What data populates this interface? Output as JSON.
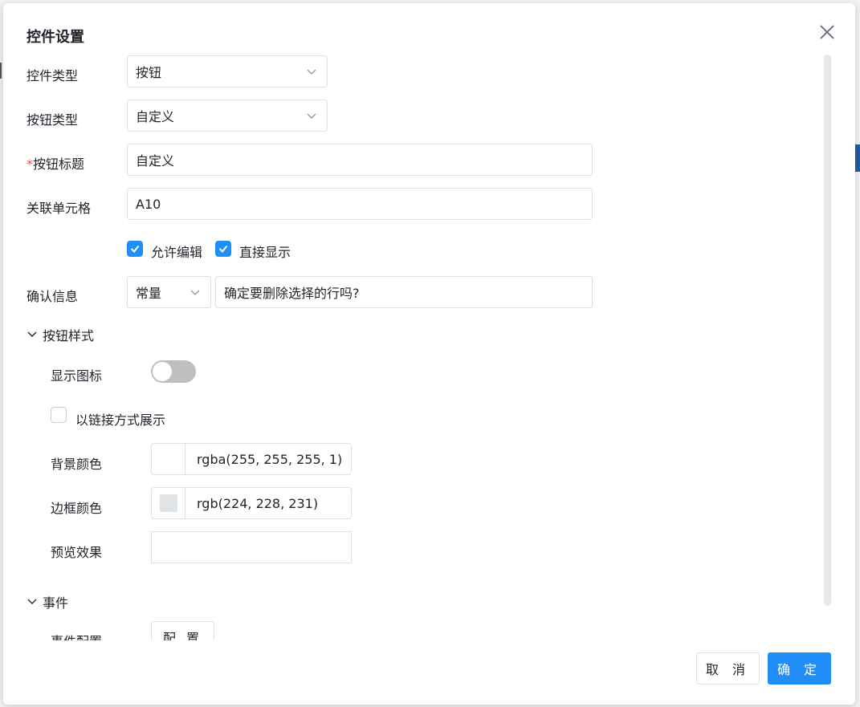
{
  "dialog": {
    "title": "控件设置",
    "cancel_label": "取 消",
    "ok_label": "确 定"
  },
  "form": {
    "control_type": {
      "label": "控件类型",
      "value": "按钮"
    },
    "button_type": {
      "label": "按钮类型",
      "value": "自定义"
    },
    "button_title": {
      "required_mark": "*",
      "label": "按钮标题",
      "value": "自定义"
    },
    "linked_cell": {
      "label": "关联单元格",
      "value": "A10"
    },
    "allow_edit": {
      "label": "允许编辑",
      "checked": true
    },
    "direct_show": {
      "label": "直接显示",
      "checked": true
    },
    "confirm_info": {
      "label": "确认信息",
      "mode": "常量",
      "value": "确定要删除选择的行吗?"
    }
  },
  "button_style": {
    "section_label": "按钮样式",
    "show_icon": {
      "label": "显示图标",
      "on": false
    },
    "link_mode": {
      "label": "以链接方式展示",
      "checked": false
    },
    "bg_color": {
      "label": "背景颜色",
      "value": "rgba(255, 255, 255, 1)",
      "swatch": "#ffffff"
    },
    "border_color": {
      "label": "边框颜色",
      "value": "rgb(224, 228, 231)",
      "swatch": "#e0e4e7"
    },
    "preview": {
      "label": "预览效果"
    }
  },
  "events": {
    "section_label": "事件",
    "config": {
      "label": "事件配置",
      "button_label": "配 置"
    }
  },
  "colors": {
    "primary": "#1f8ef8",
    "border": "#dee0e3",
    "required": "#f54a45"
  }
}
